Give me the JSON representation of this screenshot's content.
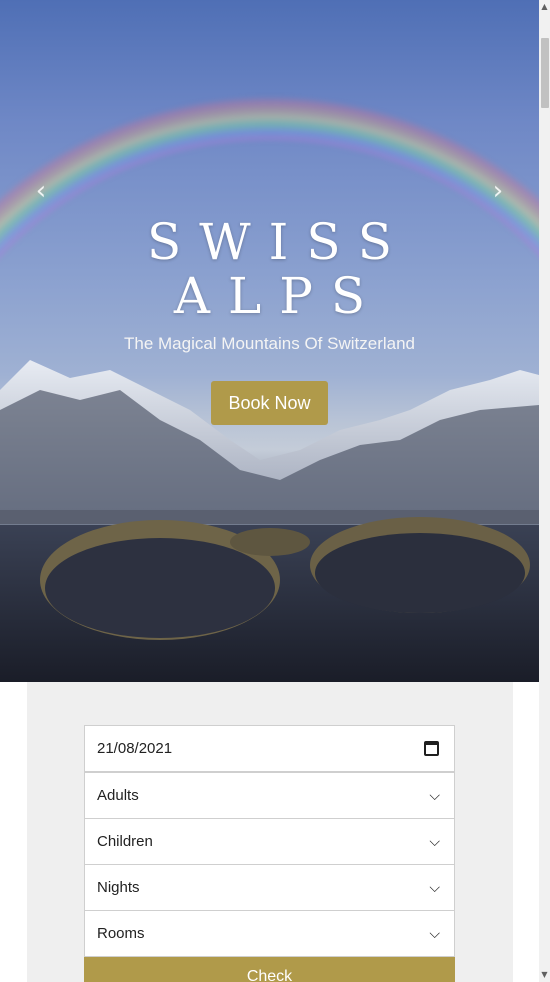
{
  "hero": {
    "title_line1": "SWISS",
    "title_line2": "ALPS",
    "subtitle": "The Magical Mountains Of Switzerland",
    "cta_label": "Book Now",
    "prev_arrow": "‹",
    "next_arrow": "›"
  },
  "booking": {
    "date_value": "21/08/2021",
    "adults_label": "Adults",
    "children_label": "Children",
    "nights_label": "Nights",
    "rooms_label": "Rooms",
    "check_label": "Check",
    "chevron": "⌵"
  },
  "colors": {
    "accent": "#b09a4a",
    "panel_bg": "#efefef"
  }
}
